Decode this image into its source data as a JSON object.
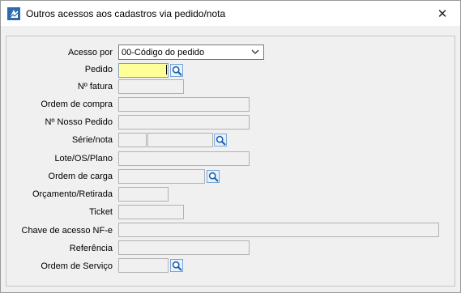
{
  "window": {
    "title": "Outros acessos aos cadastros via pedido/nota",
    "close_symbol": "✕"
  },
  "form": {
    "acesso_por": {
      "label": "Acesso por",
      "value": "00-Código do pedido"
    },
    "pedido": {
      "label": "Pedido",
      "value": ""
    },
    "numero_fatura": {
      "label": "Nº fatura",
      "value": ""
    },
    "ordem_compra": {
      "label": "Ordem de compra",
      "value": ""
    },
    "nosso_pedido": {
      "label": "Nº Nosso Pedido",
      "value": ""
    },
    "serie_nota": {
      "label": "Série/nota",
      "serie": "",
      "nota": ""
    },
    "lote_os_plano": {
      "label": "Lote/OS/Plano",
      "value": ""
    },
    "ordem_carga": {
      "label": "Ordem de carga",
      "value": ""
    },
    "orcamento_retirada": {
      "label": "Orçamento/Retirada",
      "value": ""
    },
    "ticket": {
      "label": "Ticket",
      "value": ""
    },
    "chave_nfe": {
      "label": "Chave de acesso NF-e",
      "value": ""
    },
    "referencia": {
      "label": "Referência",
      "value": ""
    },
    "ordem_servico": {
      "label": "Ordem de Serviço",
      "value": ""
    }
  },
  "icons": {
    "app": "app-logo-icon",
    "search": "search-icon",
    "dropdown": "chevron-down-icon"
  }
}
